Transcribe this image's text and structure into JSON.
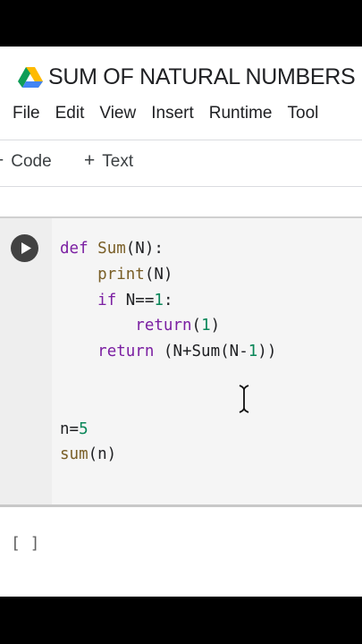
{
  "notebook": {
    "title": "SUM OF NATURAL NUMBERS",
    "drive_icon": "google-drive-icon"
  },
  "menu": {
    "items": [
      "File",
      "Edit",
      "View",
      "Insert",
      "Runtime",
      "Tool"
    ]
  },
  "toolbar": {
    "add_code_label": "Code",
    "add_text_label": "Text",
    "plus_symbol": "+"
  },
  "cell": {
    "run_icon": "play-icon",
    "code_lines": [
      "def Sum(N):",
      "    print(N)",
      "    if N==1:",
      "        return(1)",
      "    return (N+Sum(N-1))",
      "",
      "",
      "n=5",
      "sum(n)"
    ],
    "output_prompt": "[ ]"
  },
  "colors": {
    "keyword": "#7b1fa2",
    "function_name": "#795e26",
    "number": "#098658",
    "cell_background": "#f5f5f5"
  }
}
